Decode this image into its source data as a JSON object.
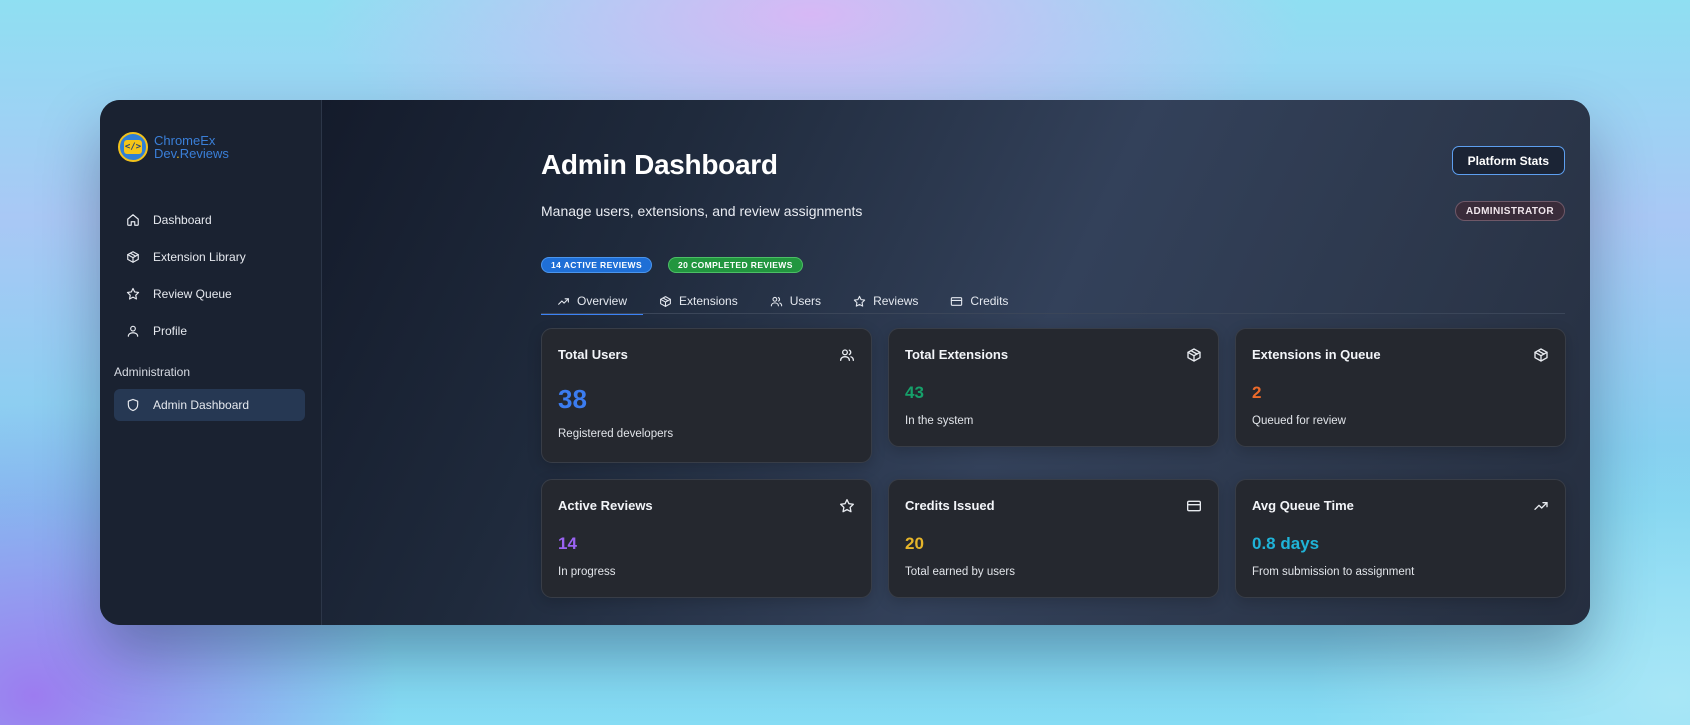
{
  "logo": {
    "line1": "ChromeEx",
    "line2_a": "Dev",
    "line2_dot": ".",
    "line2_b": "Reviews"
  },
  "sidebar": {
    "items": [
      {
        "label": "Dashboard",
        "icon": "home-icon"
      },
      {
        "label": "Extension Library",
        "icon": "package-icon"
      },
      {
        "label": "Review Queue",
        "icon": "star-icon"
      },
      {
        "label": "Profile",
        "icon": "user-icon"
      }
    ],
    "section_label": "Administration",
    "admin_item": {
      "label": "Admin Dashboard",
      "icon": "shield-icon"
    }
  },
  "header": {
    "title": "Admin Dashboard",
    "stats_button": "Platform Stats",
    "subtitle": "Manage users, extensions, and review assignments",
    "role_badge": "ADMINISTRATOR"
  },
  "pills": {
    "active": "14 ACTIVE REVIEWS",
    "completed": "20 COMPLETED REVIEWS"
  },
  "tabs": [
    {
      "label": "Overview",
      "icon": "trending-up-icon",
      "active": true
    },
    {
      "label": "Extensions",
      "icon": "package-icon"
    },
    {
      "label": "Users",
      "icon": "users-icon"
    },
    {
      "label": "Reviews",
      "icon": "star-icon"
    },
    {
      "label": "Credits",
      "icon": "credit-card-icon"
    }
  ],
  "cards": [
    {
      "title": "Total Users",
      "value": "38",
      "desc": "Registered developers",
      "icon": "users-icon",
      "color": "#3b7cf0"
    },
    {
      "title": "Total Extensions",
      "value": "43",
      "desc": "In the system",
      "icon": "package-icon",
      "color": "#16a06a"
    },
    {
      "title": "Extensions in Queue",
      "value": "2",
      "desc": "Queued for review",
      "icon": "package-icon",
      "color": "#ec6a2a"
    },
    {
      "title": "Active Reviews",
      "value": "14",
      "desc": "In progress",
      "icon": "star-icon",
      "color": "#9a63f2"
    },
    {
      "title": "Credits Issued",
      "value": "20",
      "desc": "Total earned by users",
      "icon": "credit-card-icon",
      "color": "#e6b52a"
    },
    {
      "title": "Avg Queue Time",
      "value": "0.8 days",
      "desc": "From submission to assignment",
      "icon": "trending-up-icon",
      "color": "#1fb3d8"
    }
  ]
}
